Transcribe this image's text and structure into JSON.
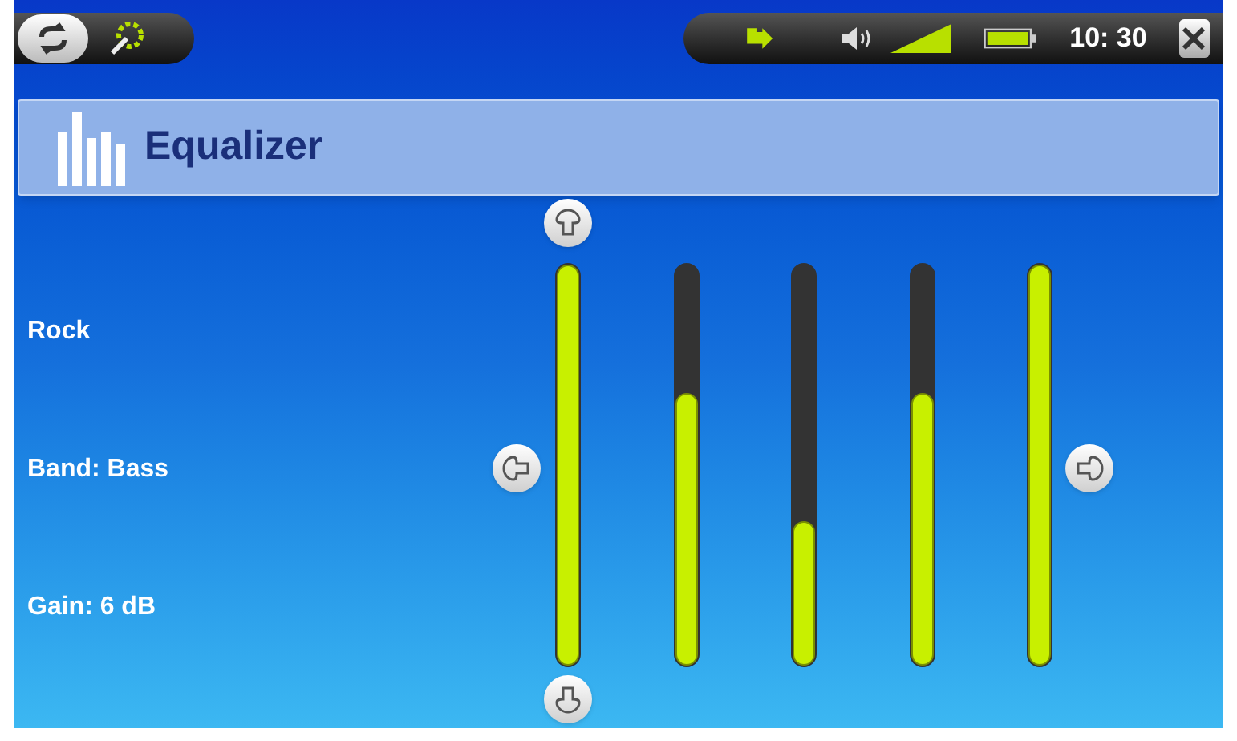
{
  "status_bar": {
    "time": "10: 30"
  },
  "header": {
    "title": "Equalizer"
  },
  "info": [
    "Rock",
    "Band: Bass",
    "Gain: 6 dB"
  ],
  "bands": [
    {
      "selected": true,
      "level": 1
    },
    {
      "selected": false,
      "level": 0.68
    },
    {
      "selected": false,
      "level": 0.36
    },
    {
      "selected": false,
      "level": 0.68
    },
    {
      "selected": false,
      "level": 1
    }
  ]
}
